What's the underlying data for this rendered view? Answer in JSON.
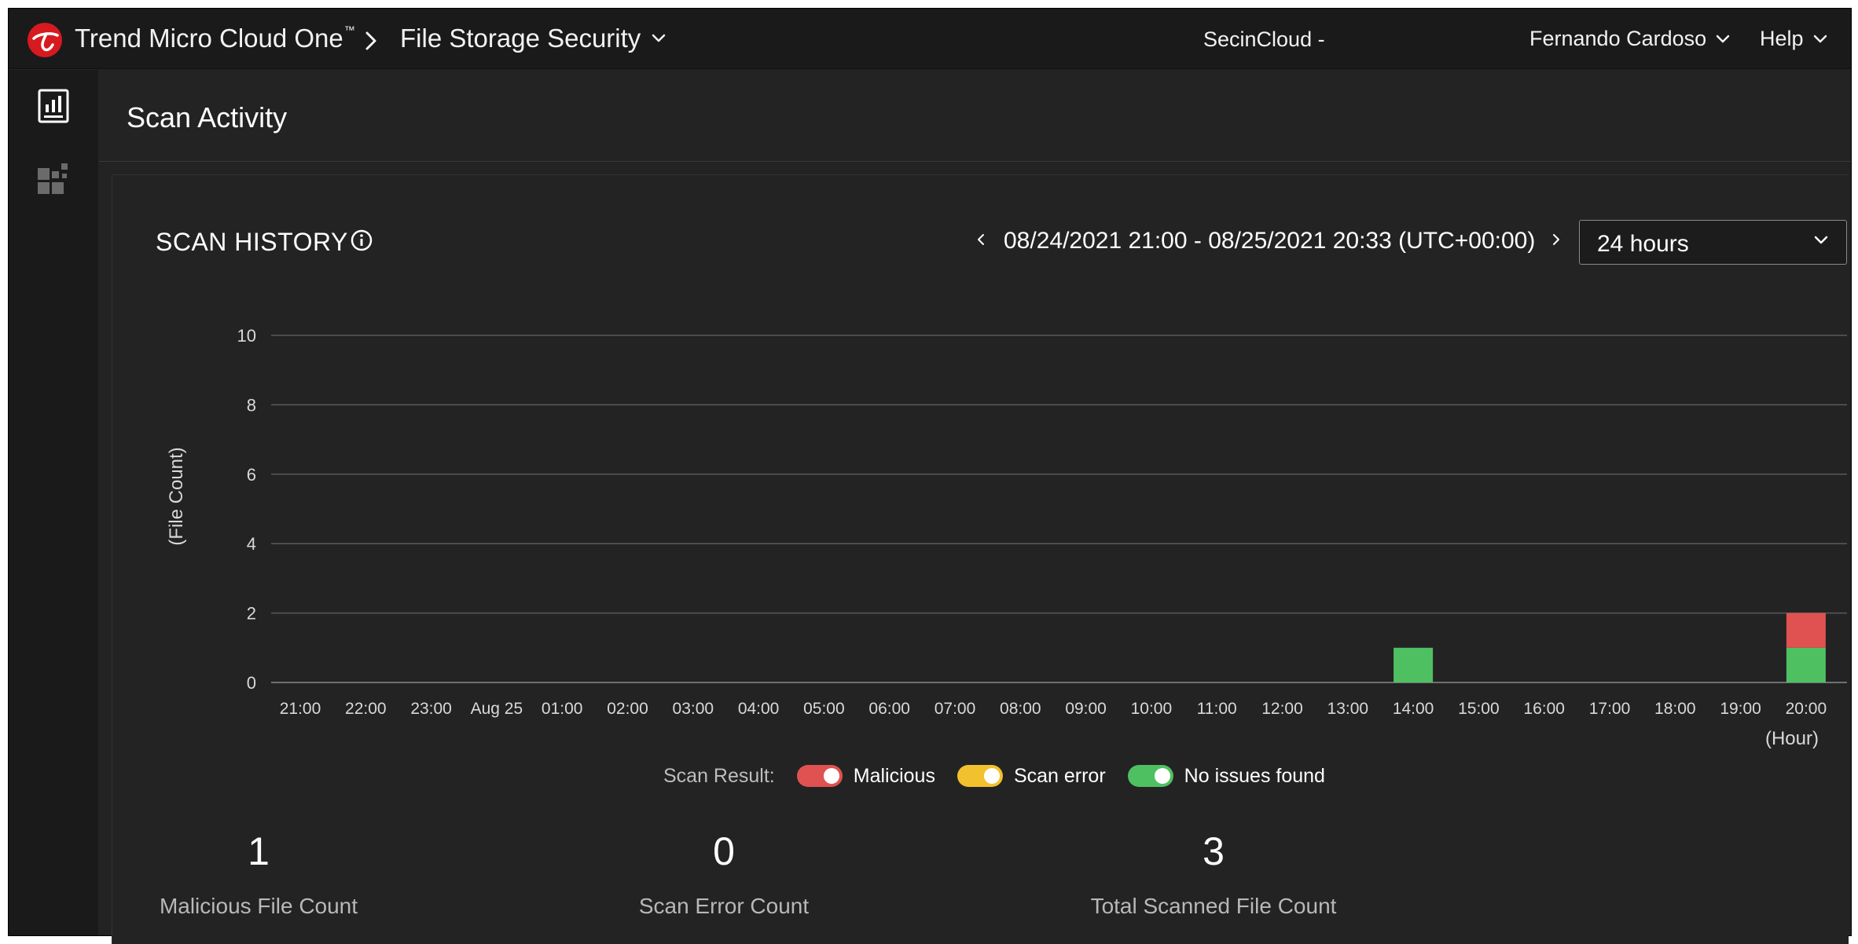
{
  "header": {
    "brand": "Trend Micro Cloud One",
    "brand_tm": "™",
    "product": "File Storage Security",
    "account": "SecinCloud -",
    "user": "Fernando Cardoso",
    "help": "Help"
  },
  "sidebar": {
    "items": [
      {
        "name": "scan-activity",
        "icon": "report-chart-icon",
        "active": true
      },
      {
        "name": "deployment",
        "icon": "stack-widgets-icon",
        "active": false
      }
    ]
  },
  "page": {
    "title": "Scan Activity"
  },
  "scan_history": {
    "title": "SCAN HISTORY",
    "range": "08/24/2021 21:00 - 08/25/2021 20:33 (UTC+00:00)",
    "period": "24 hours"
  },
  "legend": {
    "label": "Scan Result:",
    "items": [
      {
        "label": "Malicious",
        "color": "#e05252",
        "enabled": true
      },
      {
        "label": "Scan error",
        "color": "#f2c12e",
        "enabled": true
      },
      {
        "label": "No issues found",
        "color": "#4fc062",
        "enabled": true
      }
    ]
  },
  "stats": [
    {
      "value": "1",
      "label": "Malicious File Count"
    },
    {
      "value": "0",
      "label": "Scan Error Count"
    },
    {
      "value": "3",
      "label": "Total Scanned File Count"
    }
  ],
  "chart_data": {
    "type": "bar",
    "stacked": true,
    "categories": [
      "21:00",
      "22:00",
      "23:00",
      "Aug 25",
      "01:00",
      "02:00",
      "03:00",
      "04:00",
      "05:00",
      "06:00",
      "07:00",
      "08:00",
      "09:00",
      "10:00",
      "11:00",
      "12:00",
      "13:00",
      "14:00",
      "15:00",
      "16:00",
      "17:00",
      "18:00",
      "19:00",
      "20:00"
    ],
    "series": [
      {
        "name": "No issues found",
        "color": "#4fc062",
        "values": [
          0,
          0,
          0,
          0,
          0,
          0,
          0,
          0,
          0,
          0,
          0,
          0,
          0,
          0,
          0,
          0,
          0,
          1,
          0,
          0,
          0,
          0,
          0,
          1
        ]
      },
      {
        "name": "Scan error",
        "color": "#f2c12e",
        "values": [
          0,
          0,
          0,
          0,
          0,
          0,
          0,
          0,
          0,
          0,
          0,
          0,
          0,
          0,
          0,
          0,
          0,
          0,
          0,
          0,
          0,
          0,
          0,
          0
        ]
      },
      {
        "name": "Malicious",
        "color": "#e05252",
        "values": [
          0,
          0,
          0,
          0,
          0,
          0,
          0,
          0,
          0,
          0,
          0,
          0,
          0,
          0,
          0,
          0,
          0,
          0,
          0,
          0,
          0,
          0,
          0,
          1
        ]
      }
    ],
    "ylabel": "(File Count)",
    "xlabel": "(Hour)",
    "yticks": [
      0,
      2,
      4,
      6,
      8,
      10
    ],
    "ylim": [
      0,
      10
    ],
    "grid": true
  }
}
